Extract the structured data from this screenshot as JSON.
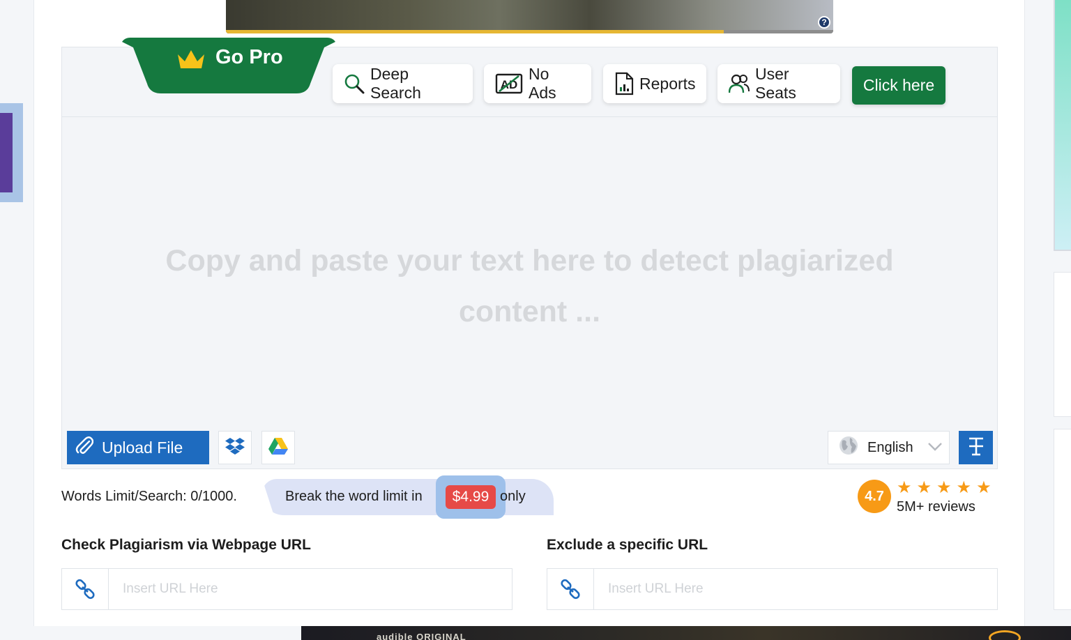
{
  "video": {
    "progress_fraction": 0.82,
    "help_glyph": "?"
  },
  "go_pro": {
    "label": "Go Pro",
    "color": "#15793f"
  },
  "toolbar": {
    "deep_search": "Deep Search",
    "no_ads": "No Ads",
    "no_ads_icon_text": "AD",
    "reports": "Reports",
    "user_seats": "User Seats",
    "click_here": "Click here"
  },
  "editor": {
    "placeholder": "Copy and paste your text here to detect plagiarized content ..."
  },
  "bottom_controls": {
    "upload_file": "Upload File",
    "language": "English"
  },
  "limits": {
    "words_limit": "Words Limit/Search: 0/1000.",
    "break_text": "Break the word limit in",
    "price": "$4.99",
    "only": "only"
  },
  "rating": {
    "score": "4.7",
    "stars": 5,
    "reviews": "5M+ reviews"
  },
  "url_check": {
    "title": "Check Plagiarism via Webpage URL",
    "placeholder": "Insert URL Here"
  },
  "url_exclude": {
    "title": "Exclude a specific URL",
    "placeholder": "Insert URL Here"
  },
  "ad_banner": {
    "text": "audible ORIGINAL"
  },
  "colors": {
    "brand_green": "#15793f",
    "brand_blue": "#1e6bbf",
    "price_red": "#e64a47",
    "rating_orange": "#f79a16"
  }
}
